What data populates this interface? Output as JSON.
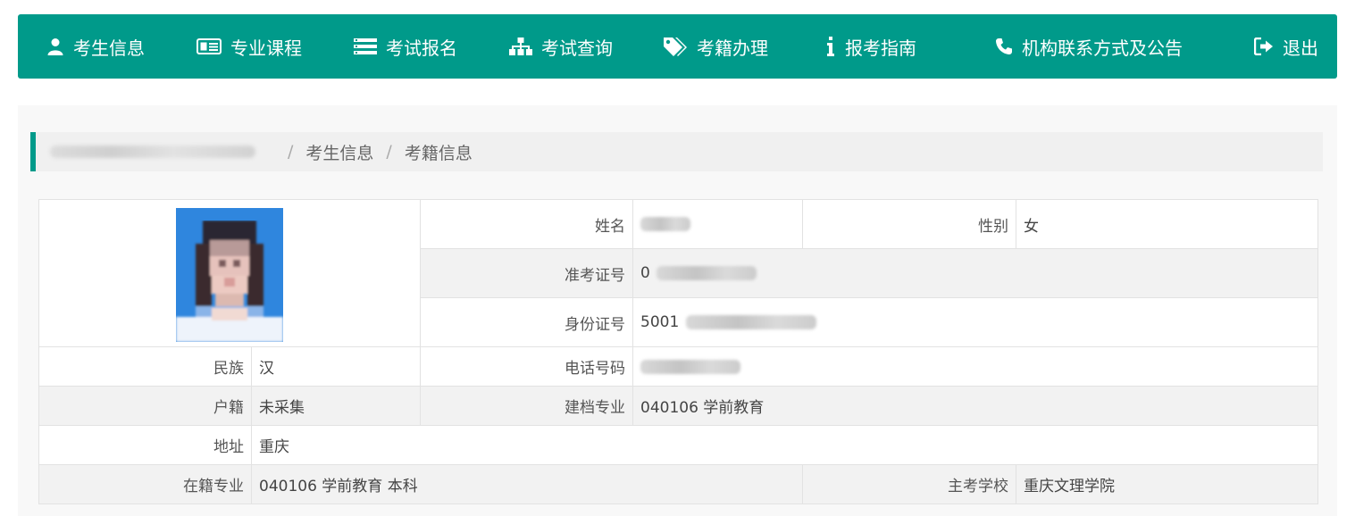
{
  "nav": {
    "items": [
      {
        "label": "考生信息",
        "icon": "user-icon"
      },
      {
        "label": "专业课程",
        "icon": "id-card-icon"
      },
      {
        "label": "考试报名",
        "icon": "list-icon"
      },
      {
        "label": "考试查询",
        "icon": "sitemap-icon"
      },
      {
        "label": "考籍办理",
        "icon": "tags-icon"
      },
      {
        "label": "报考指南",
        "icon": "info-icon"
      },
      {
        "label": "机构联系方式及公告",
        "icon": "phone-icon"
      },
      {
        "label": "退出",
        "icon": "sign-out-icon"
      }
    ]
  },
  "breadcrumb": {
    "sep": "/",
    "items": [
      "考生信息",
      "考籍信息"
    ]
  },
  "student": {
    "name_label": "姓名",
    "gender_label": "性别",
    "gender": "女",
    "admission_label": "准考证号",
    "admission_prefix": "0",
    "id_label": "身份证号",
    "id_prefix": "5001",
    "ethnicity_label": "民族",
    "ethnicity": "汉",
    "phone_label": "电话号码",
    "household_label": "户籍",
    "household": "未采集",
    "filed_major_label": "建档专业",
    "filed_major": "040106 学前教育",
    "address_label": "地址",
    "address": "重庆",
    "enrolled_major_label": "在籍专业",
    "enrolled_major": "040106 学前教育 本科",
    "school_label": "主考学校",
    "school": "重庆文理学院"
  },
  "colors": {
    "accent": "#009a8a"
  }
}
